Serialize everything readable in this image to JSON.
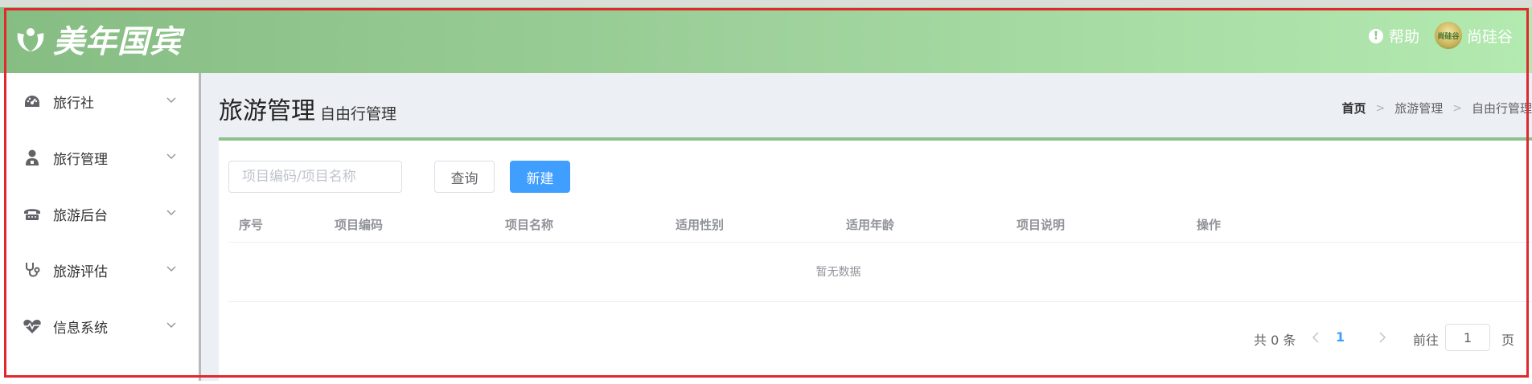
{
  "header": {
    "logo_text": "美年国宾",
    "help_label": "帮助",
    "user_name": "尚硅谷",
    "avatar_text": "尚硅谷"
  },
  "sidebar": {
    "items": [
      {
        "label": "旅行社",
        "icon": "dashboard-icon"
      },
      {
        "label": "旅行管理",
        "icon": "user-doctor-icon"
      },
      {
        "label": "旅游后台",
        "icon": "phone-icon"
      },
      {
        "label": "旅游评估",
        "icon": "stethoscope-icon"
      },
      {
        "label": "信息系统",
        "icon": "heartbeat-icon"
      }
    ]
  },
  "page": {
    "title": "旅游管理",
    "subtitle": "自由行管理",
    "breadcrumb": [
      "首页",
      "旅游管理",
      "自由行管理"
    ]
  },
  "toolbar": {
    "search_placeholder": "项目编码/项目名称",
    "search_value": "",
    "query_label": "查询",
    "new_label": "新建"
  },
  "table": {
    "columns": [
      "序号",
      "项目编码",
      "项目名称",
      "适用性别",
      "适用年龄",
      "项目说明",
      "操作"
    ],
    "empty_text": "暂无数据"
  },
  "pagination": {
    "total_text": "共 0 条",
    "current_page": "1",
    "goto_label": "前往",
    "goto_value": "1",
    "page_suffix": "页"
  },
  "colors": {
    "header_start": "#86bd83",
    "header_end": "#b3eab0",
    "primary": "#409eff",
    "highlight_outline": "#e0282e"
  }
}
